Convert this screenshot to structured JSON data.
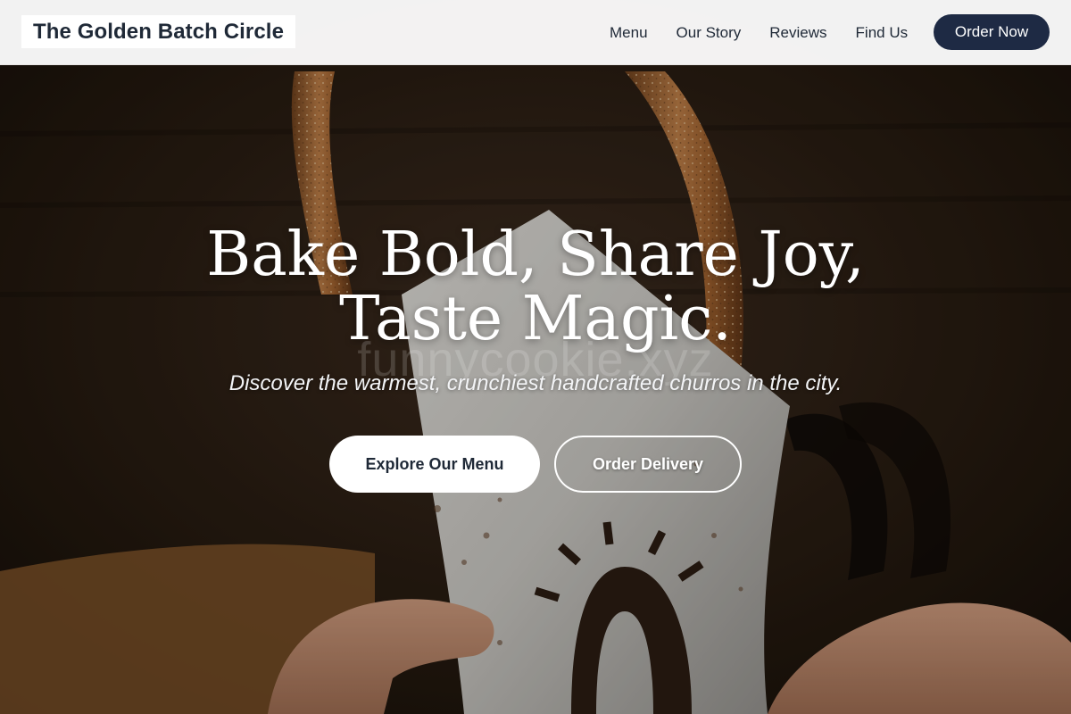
{
  "nav": {
    "brand": "The Golden Batch Circle",
    "links": [
      "Menu",
      "Our Story",
      "Reviews",
      "Find Us"
    ],
    "cta": "Order Now"
  },
  "hero": {
    "headline_line1": "Bake Bold, Share Joy,",
    "headline_line2": "Taste Magic.",
    "watermark": "funnycookie.xyz",
    "tagline": "Discover the warmest, crunchiest handcrafted churros in the city.",
    "primary_button": "Explore Our Menu",
    "secondary_button": "Order Delivery",
    "image_icon": "churros-photo"
  },
  "colors": {
    "nav_bg": "#fafafa",
    "brand_text": "#1f2937",
    "cta_bg": "#1e2a44",
    "hero_text": "#ffffff"
  }
}
